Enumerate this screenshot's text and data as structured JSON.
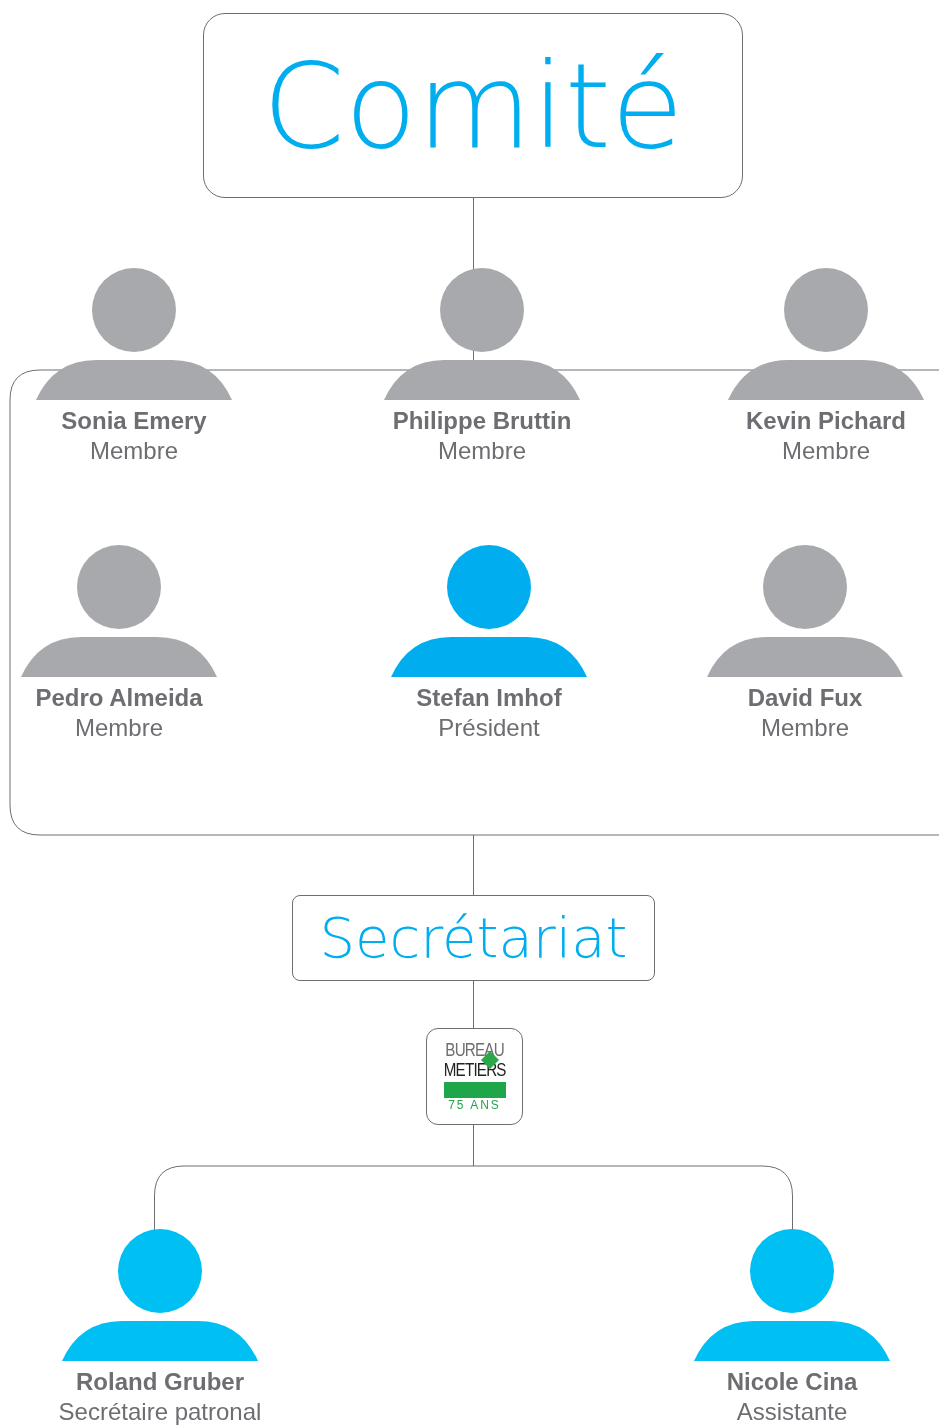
{
  "title": "Comité",
  "members": [
    {
      "name": "Sonia Emery",
      "role": "Membre",
      "color": "#a7a9ac"
    },
    {
      "name": "Philippe Bruttin",
      "role": "Membre",
      "color": "#a7a9ac"
    },
    {
      "name": "Kevin Pichard",
      "role": "Membre",
      "color": "#a7a9ac"
    },
    {
      "name": "Pedro Almeida",
      "role": "Membre",
      "color": "#a7a9ac"
    },
    {
      "name": "Stefan Imhof",
      "role": "Président",
      "color": "#00aeef"
    },
    {
      "name": "David Fux",
      "role": "Membre",
      "color": "#a7a9ac"
    }
  ],
  "secretariat": {
    "title": "Secrétariat",
    "logo": {
      "line_1": "BUREAU",
      "line_2": "METIERS",
      "line_3": "75 ANS"
    }
  },
  "staff": [
    {
      "name": "Roland Gruber",
      "role": "Secrétaire patronal",
      "color": "#00bff3"
    },
    {
      "name": "Nicole Cina",
      "role": "Assistante",
      "color": "#00bff3"
    }
  ]
}
